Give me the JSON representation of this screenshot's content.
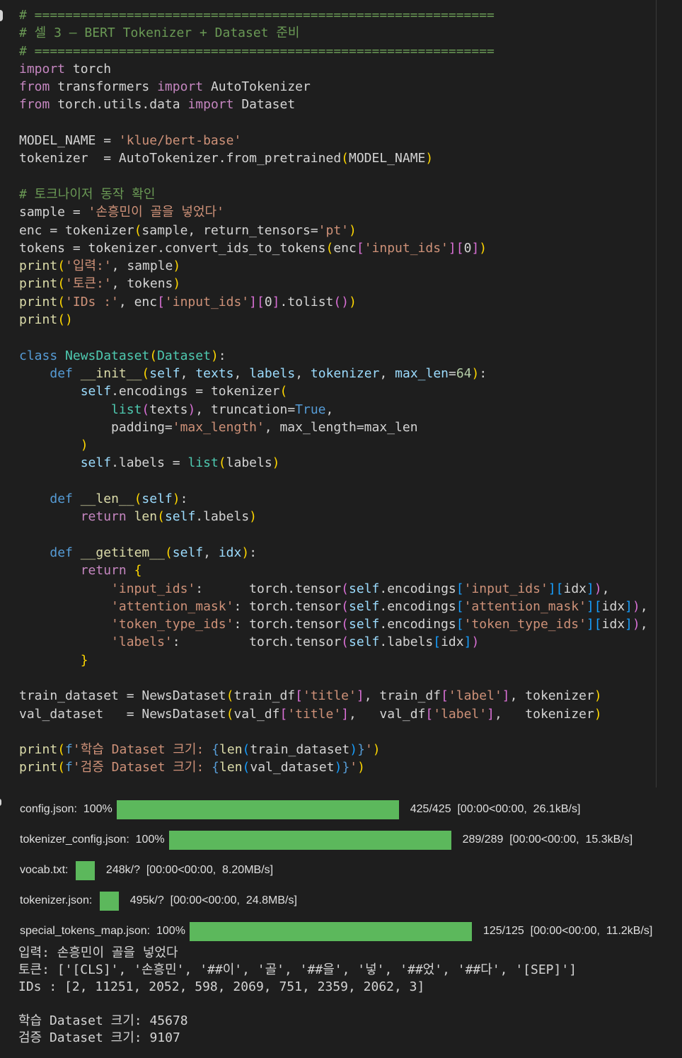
{
  "code": {
    "header_rule": "# ============================================================",
    "header_title": "# 셀 3 — BERT Tokenizer + Dataset 준비",
    "import1_name": "torch",
    "import2_mod": "transformers",
    "import2_name": "AutoTokenizer",
    "import3_mod": "torch.utils.data",
    "import3_name": "Dataset",
    "model_name_value": "'klue/bert-base'",
    "tok_comment": "# 토크나이저 동작 확인",
    "sample_value": "'손흥민이 골을 넣었다'",
    "str_pt": "'pt'",
    "str_input_ids": "'input_ids'",
    "str_in": "'입력:'",
    "str_tok": "'토큰:'",
    "str_ids": "'IDs :'",
    "class_name": "NewsDataset",
    "max_len_default": "64",
    "true_kw": "True",
    "str_max_length": "'max_length'",
    "key_input_ids": "'input_ids'",
    "key_attention_mask": "'attention_mask'",
    "key_token_type_ids": "'token_type_ids'",
    "key_labels": "'labels'",
    "str_title": "'title'",
    "str_label": "'label'",
    "fstr_train_a": "'학습 Dataset 크기: ",
    "fstr_val_a": "'검증 Dataset 크기: ",
    "fstr_end": "'"
  },
  "progress": [
    {
      "label": "config.json:  100%",
      "percent": 100,
      "stats": "425/425  [00:00<00:00,  26.1kB/s]"
    },
    {
      "label": "tokenizer_config.json:  100%",
      "percent": 100,
      "stats": "289/289  [00:00<00:00,  15.3kB/s]"
    },
    {
      "label": "vocab.txt: ",
      "percent": null,
      "stats": "248k/?  [00:00<00:00,  8.20MB/s]"
    },
    {
      "label": "tokenizer.json: ",
      "percent": null,
      "stats": "495k/?  [00:00<00:00,  24.8MB/s]"
    },
    {
      "label": "special_tokens_map.json:  100%",
      "percent": 100,
      "stats": "125/125  [00:00<00:00,  11.2kB/s]"
    }
  ],
  "stdout": {
    "input_line": "입력: 손흥민이 골을 넣었다",
    "tokens_line": "토큰: ['[CLS]', '손흥민', '##이', '골', '##을', '넣', '##었', '##다', '[SEP]']",
    "ids_line": "IDs : [2, 11251, 2052, 598, 2069, 751, 2359, 2062, 3]",
    "train_size_line": "학습 Dataset 크기: 45678",
    "val_size_line": "검증 Dataset 크기: 9107"
  },
  "colors": {
    "background": "#1e1e1e",
    "progress_fill": "#5cb85c",
    "comment": "#6a9955",
    "keyword": "#c586c0",
    "string": "#ce9178"
  }
}
